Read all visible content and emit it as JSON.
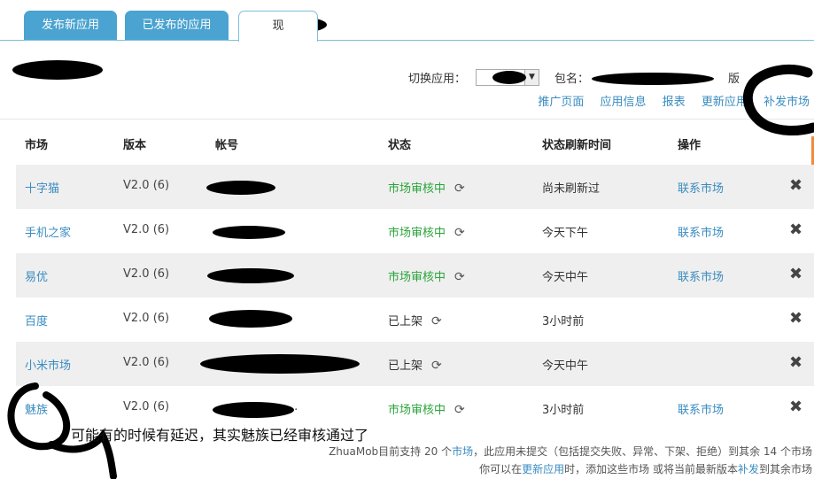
{
  "tabs": [
    {
      "label": "发布新应用"
    },
    {
      "label": "已发布的应用"
    },
    {
      "label": "现"
    }
  ],
  "toolbar": {
    "switch_label": "切换应用：",
    "select_value": "",
    "pkg_label": "包名：",
    "ver_label": "版"
  },
  "links": [
    "推广页面",
    "应用信息",
    "报表",
    "更新应用",
    "补发市场"
  ],
  "table": {
    "headers": [
      "市场",
      "版本",
      "帐号",
      "状态",
      "状态刷新时间",
      "操作"
    ],
    "rows": [
      {
        "market": "十字猫",
        "version": "V2.0 (6)",
        "account": "",
        "status": "市场审核中",
        "status_color": "#2aa53a",
        "time": "尚未刷新过",
        "action": "联系市场"
      },
      {
        "market": "手机之家",
        "version": "V2.0 (6)",
        "account": "",
        "status": "市场审核中",
        "status_color": "#2aa53a",
        "time": "今天下午",
        "action": "联系市场"
      },
      {
        "market": "易优",
        "version": "V2.0 (6)",
        "account": "",
        "status": "市场审核中",
        "status_color": "#2aa53a",
        "time": "今天中午",
        "action": "联系市场"
      },
      {
        "market": "百度",
        "version": "V2.0 (6)",
        "account": "",
        "status": "已上架",
        "status_color": "#333333",
        "time": "3小时前",
        "action": ""
      },
      {
        "market": "小米市场",
        "version": "V2.0 (6)",
        "account": "",
        "status": "已上架",
        "status_color": "#333333",
        "time": "今天中午",
        "action": ""
      },
      {
        "market": "魅族",
        "version": "V2.0 (6)",
        "account": "..",
        "status": "市场审核中",
        "status_color": "#2aa53a",
        "time": "3小时前",
        "action": "联系市场"
      }
    ]
  },
  "footer": {
    "line1_a": "ZhuaMob目前支持 20 个",
    "line1_link": "市场",
    "line1_b": "，此应用未提交（包括提交失败、异常、下架、拒绝）到其余 14 个市场",
    "line2_a": "你可以在",
    "line2_link1": "更新应用",
    "line2_b": "时，添加这些市场 或将当前最新版本",
    "line2_link2": "补发",
    "line2_c": "到其余市场"
  },
  "annotation": "可能有的时候有延迟，其实魅族已经审核通过了",
  "icons": {
    "refresh": "refresh-icon",
    "delete": "delete-icon",
    "select_arrow": "chevron-down-icon"
  }
}
